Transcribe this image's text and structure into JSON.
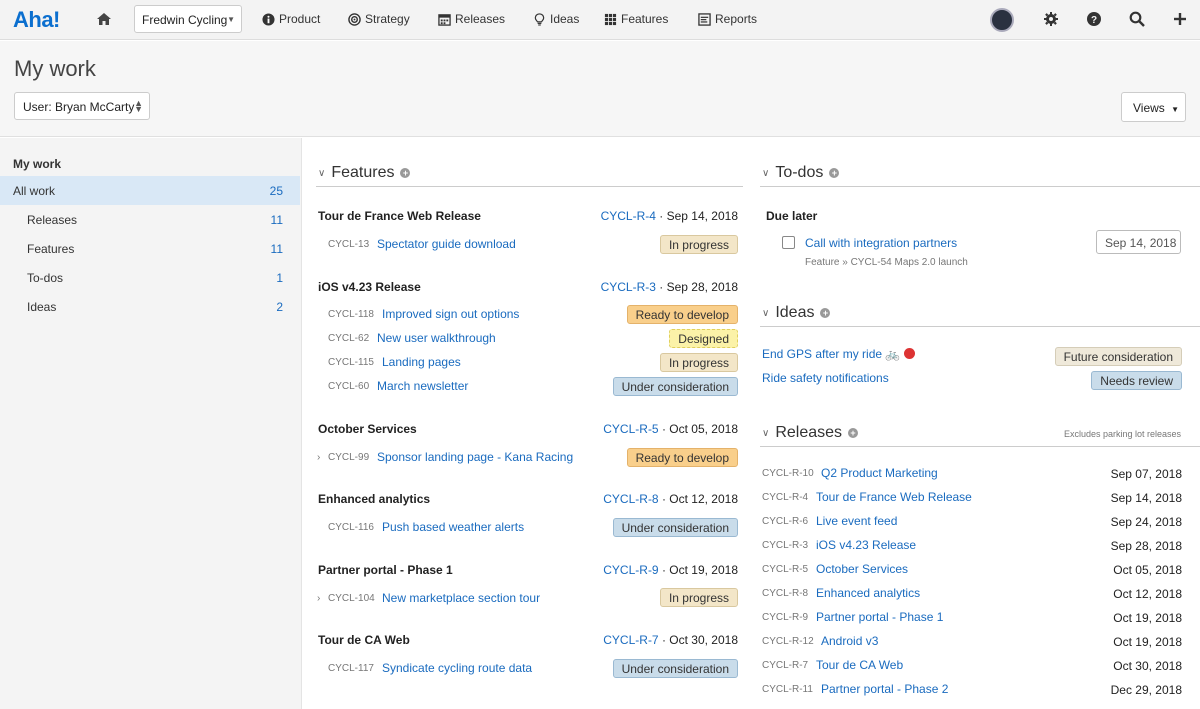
{
  "topbar": {
    "logo": "Aha!",
    "workspace": "Fredwin Cycling",
    "nav": [
      {
        "label": "Product",
        "icon": "info-circle-icon"
      },
      {
        "label": "Strategy",
        "icon": "target-icon"
      },
      {
        "label": "Releases",
        "icon": "calendar-icon"
      },
      {
        "label": "Ideas",
        "icon": "lightbulb-icon"
      },
      {
        "label": "Features",
        "icon": "grid-icon"
      },
      {
        "label": "Reports",
        "icon": "report-icon"
      }
    ]
  },
  "page": {
    "title": "My work",
    "user_select": "User: Bryan McCarty",
    "views": "Views"
  },
  "sidebar": {
    "heading": "My work",
    "items": [
      {
        "label": "All work",
        "count": "25"
      },
      {
        "label": "Releases",
        "count": "11"
      },
      {
        "label": "Features",
        "count": "11"
      },
      {
        "label": "To-dos",
        "count": "1"
      },
      {
        "label": "Ideas",
        "count": "2"
      }
    ]
  },
  "features": {
    "heading": "Features",
    "groups": [
      {
        "title": "Tour de France Web Release",
        "release": "CYCL-R-4",
        "date": "Sep 14, 2018",
        "items": [
          {
            "ref": "CYCL-13",
            "name": "Spectator guide download",
            "status": "In progress"
          }
        ]
      },
      {
        "title": "iOS v4.23 Release",
        "release": "CYCL-R-3",
        "date": "Sep 28, 2018",
        "items": [
          {
            "ref": "CYCL-118",
            "name": "Improved sign out options",
            "status": "Ready to develop"
          },
          {
            "ref": "CYCL-62",
            "name": "New user walkthrough",
            "status": "Designed"
          },
          {
            "ref": "CYCL-115",
            "name": "Landing pages",
            "status": "In progress"
          },
          {
            "ref": "CYCL-60",
            "name": "March newsletter",
            "status": "Under consideration"
          }
        ]
      },
      {
        "title": "October Services",
        "release": "CYCL-R-5",
        "date": "Oct 05, 2018",
        "items": [
          {
            "ref": "CYCL-99",
            "name": "Sponsor landing page - Kana Racing",
            "status": "Ready to develop"
          }
        ]
      },
      {
        "title": "Enhanced analytics",
        "release": "CYCL-R-8",
        "date": "Oct 12, 2018",
        "items": [
          {
            "ref": "CYCL-116",
            "name": "Push based weather alerts",
            "status": "Under consideration"
          }
        ]
      },
      {
        "title": "Partner portal - Phase 1",
        "release": "CYCL-R-9",
        "date": "Oct 19, 2018",
        "items": [
          {
            "ref": "CYCL-104",
            "name": "New marketplace section tour",
            "status": "In progress"
          }
        ]
      },
      {
        "title": "Tour de CA Web",
        "release": "CYCL-R-7",
        "date": "Oct 30, 2018",
        "items": [
          {
            "ref": "CYCL-117",
            "name": "Syndicate cycling route data",
            "status": "Under consideration"
          }
        ]
      }
    ]
  },
  "todos": {
    "heading": "To-dos",
    "group": "Due later",
    "item": "Call with integration partners",
    "date": "Sep 14, 2018",
    "sub": "Feature » CYCL-54 Maps 2.0 launch"
  },
  "ideas": {
    "heading": "Ideas",
    "items": [
      {
        "name": "End GPS after my ride",
        "status": "Future consideration"
      },
      {
        "name": "Ride safety notifications",
        "status": "Needs review"
      }
    ]
  },
  "releases": {
    "heading": "Releases",
    "note": "Excludes parking lot releases",
    "items": [
      {
        "ref": "CYCL-R-10",
        "name": "Q2 Product Marketing",
        "date": "Sep 07, 2018"
      },
      {
        "ref": "CYCL-R-4",
        "name": "Tour de France Web Release",
        "date": "Sep 14, 2018"
      },
      {
        "ref": "CYCL-R-6",
        "name": "Live event feed",
        "date": "Sep 24, 2018"
      },
      {
        "ref": "CYCL-R-3",
        "name": "iOS v4.23 Release",
        "date": "Sep 28, 2018"
      },
      {
        "ref": "CYCL-R-5",
        "name": "October Services",
        "date": "Oct 05, 2018"
      },
      {
        "ref": "CYCL-R-8",
        "name": "Enhanced analytics",
        "date": "Oct 12, 2018"
      },
      {
        "ref": "CYCL-R-9",
        "name": "Partner portal - Phase 1",
        "date": "Oct 19, 2018"
      },
      {
        "ref": "CYCL-R-12",
        "name": "Android v3",
        "date": "Oct 19, 2018"
      },
      {
        "ref": "CYCL-R-7",
        "name": "Tour de CA Web",
        "date": "Oct 30, 2018"
      },
      {
        "ref": "CYCL-R-11",
        "name": "Partner portal - Phase 2",
        "date": "Dec 29, 2018"
      }
    ]
  }
}
